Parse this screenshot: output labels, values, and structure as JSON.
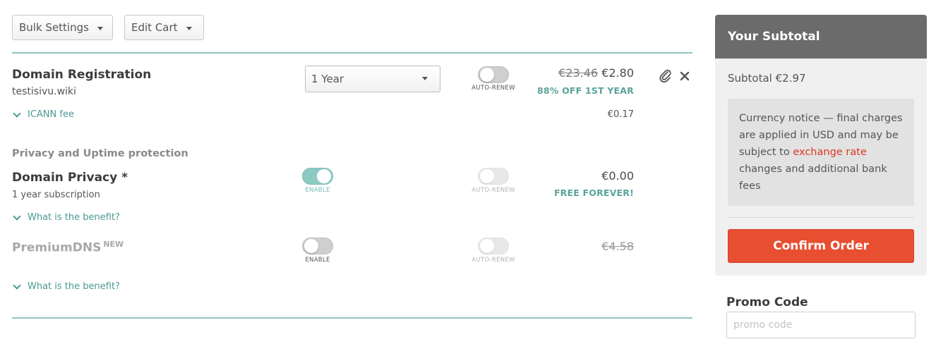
{
  "toolbar": {
    "bulk_settings_label": "Bulk Settings",
    "edit_cart_label": "Edit Cart"
  },
  "domain_registration": {
    "title": "Domain Registration",
    "domain": "testisivu.wiki",
    "period": "1 Year",
    "auto_renew_label": "AUTO-RENEW",
    "old_price": "€23.46",
    "price": "€2.80",
    "discount": "88% OFF 1ST YEAR",
    "icann_fee_label": "ICANN fee",
    "icann_fee_price": "€0.17"
  },
  "privacy_section": {
    "heading": "Privacy and Uptime protection",
    "domain_privacy": {
      "title": "Domain Privacy *",
      "subtitle": "1 year subscription",
      "enable_label": "ENABLE",
      "enabled": true,
      "auto_renew_label": "AUTO-RENEW",
      "price": "€0.00",
      "tag": "FREE FOREVER!",
      "benefit_link": "What is the benefit?"
    },
    "premium_dns": {
      "title": "PremiumDNS",
      "badge": "NEW",
      "enable_label": "ENABLE",
      "enabled": false,
      "auto_renew_label": "AUTO-RENEW",
      "price": "€4.58",
      "benefit_link": "What is the benefit?"
    }
  },
  "summary": {
    "heading": "Your Subtotal",
    "subtotal_label": "Subtotal",
    "subtotal_value": "€2.97",
    "notice_before": "Currency notice — final charges are applied in USD and may be subject to ",
    "notice_link": "exchange rate",
    "notice_after": " changes and additional bank fees",
    "confirm_label": "Confirm Order"
  },
  "promo": {
    "heading": "Promo Code",
    "placeholder": "promo code"
  },
  "colors": {
    "accent_teal": "#5aa39b",
    "confirm_red": "#e84e30",
    "panel_header": "#6b6b6b"
  },
  "icons": [
    "chevron-down-icon",
    "paperclip-icon",
    "close-icon",
    "caret-down-icon"
  ]
}
